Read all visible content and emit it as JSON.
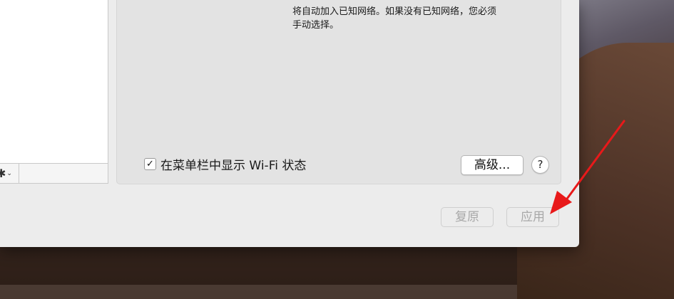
{
  "desktop": {
    "wallpaper": "desert-dunes"
  },
  "sidebar": {
    "action_menu": {
      "icons": [
        "gear-icon",
        "chevron-down-icon"
      ]
    }
  },
  "panel": {
    "description": "将自动加入已知网络。如果没有已知网络，您必须\n手动选择。",
    "show_wifi_status": {
      "label": "在菜单栏中显示 Wi-Fi 状态",
      "checked": true
    },
    "advanced_label": "高级...",
    "help_label": "?"
  },
  "footer": {
    "revert_label": "复原",
    "apply_label": "应用"
  },
  "colors": {
    "annotation_arrow": "#e8191a",
    "disabled_text": "#a8a8a8"
  }
}
